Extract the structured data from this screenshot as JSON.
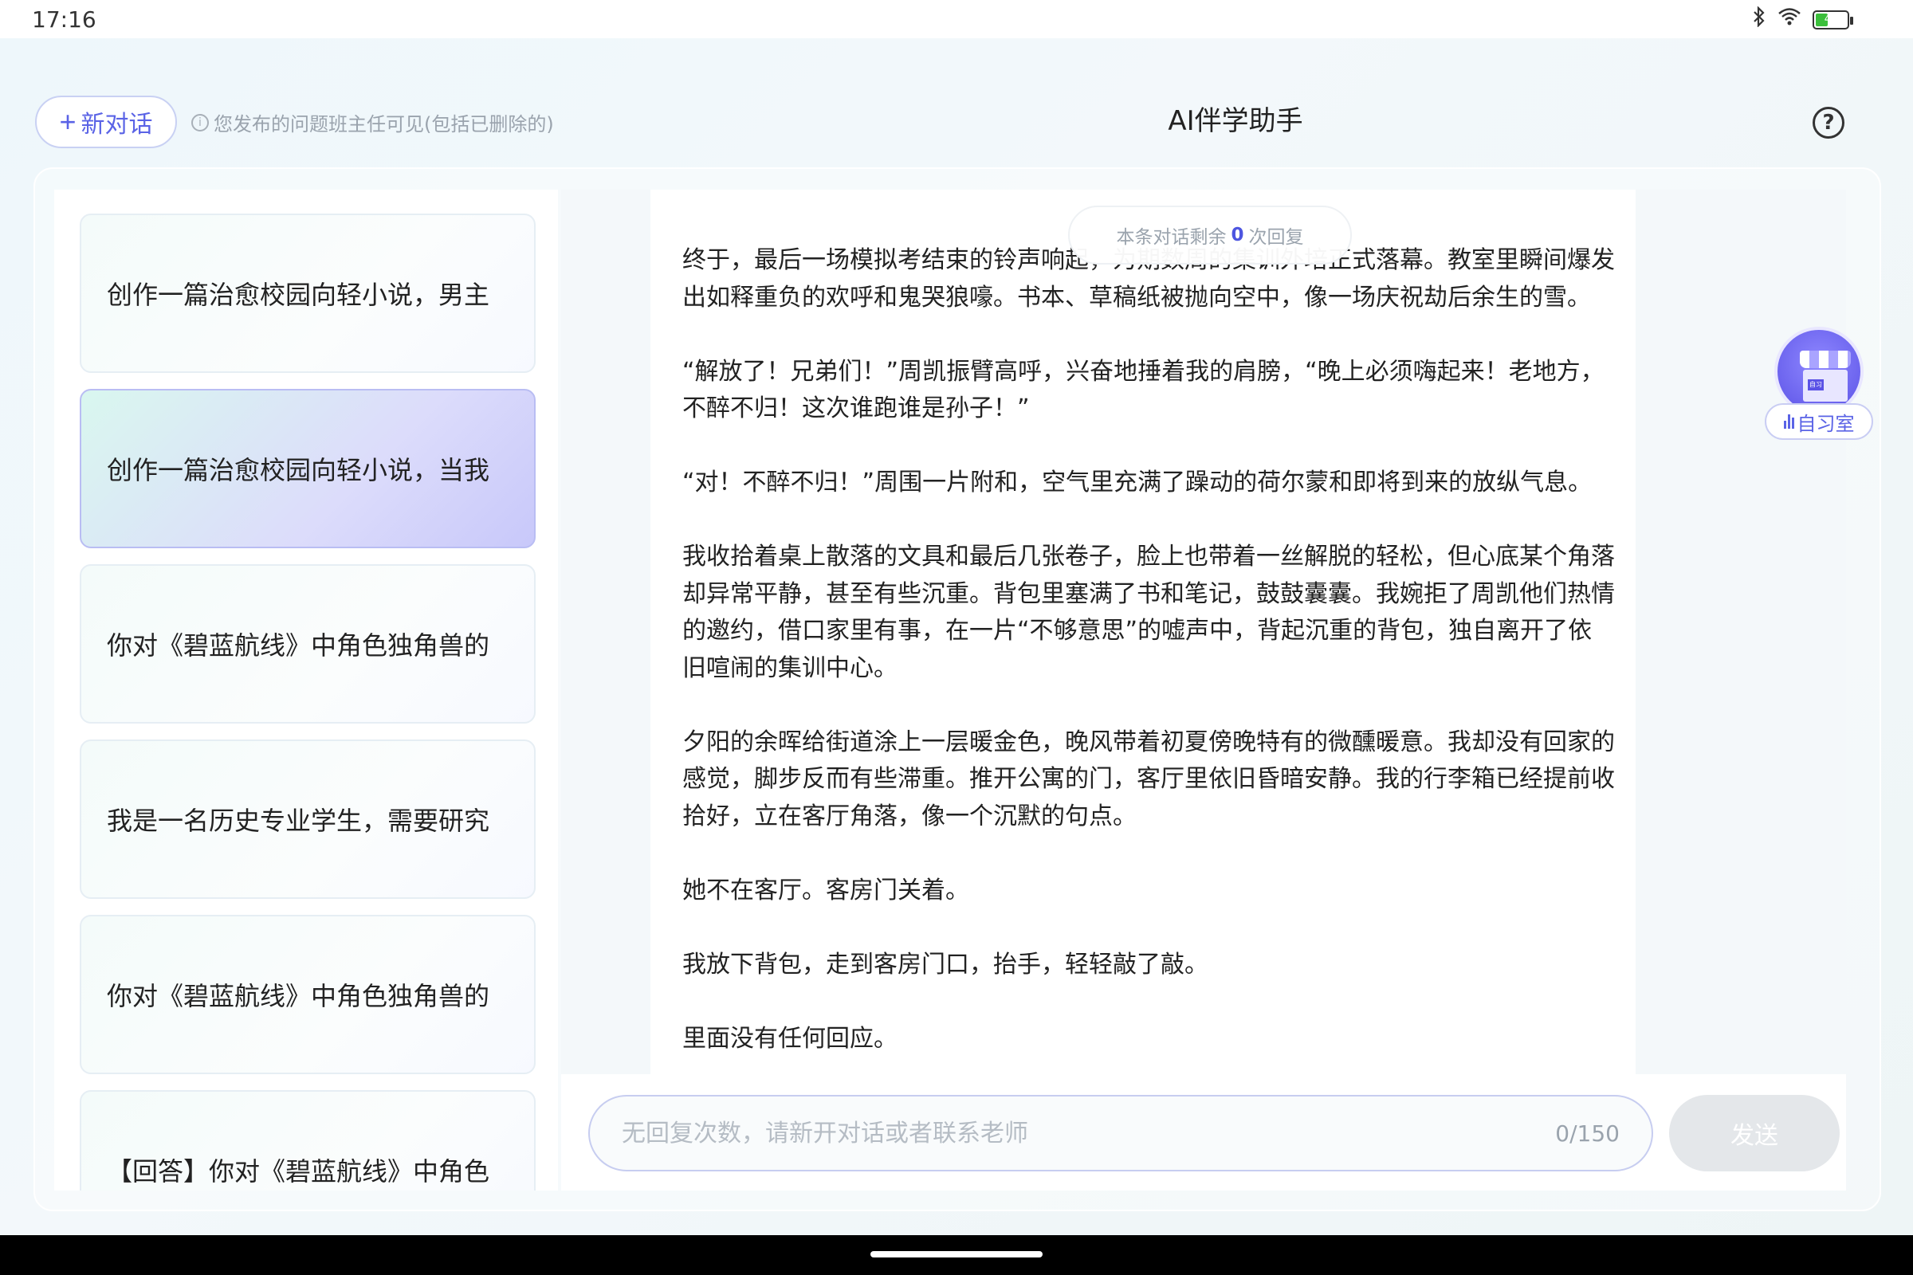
{
  "status_bar": {
    "time": "17:16",
    "battery_level": 46,
    "battery_label": "46"
  },
  "header": {
    "new_chat_label": "新对话",
    "notice": "您发布的问题班主任可见(包括已删除的)",
    "title": "AI伴学助手",
    "help_glyph": "?"
  },
  "conversations": [
    {
      "label": "创作一篇治愈校园向轻小说，男主",
      "active": false
    },
    {
      "label": "创作一篇治愈校园向轻小说，当我",
      "active": true
    },
    {
      "label": "你对《碧蓝航线》中角色独角兽的",
      "active": false
    },
    {
      "label": "我是一名历史专业学生，需要研究",
      "active": false
    },
    {
      "label": "你对《碧蓝航线》中角色独角兽的",
      "active": false
    },
    {
      "label": "【回答】你对《碧蓝航线》中角色",
      "active": false
    }
  ],
  "remaining": {
    "prefix": "本条对话剩余",
    "count": "0",
    "suffix": "次回复"
  },
  "message": {
    "paragraphs": [
      "终于，最后一场模拟考结束的铃声响起，为期数周的集训外培正式落幕。教室里瞬间爆发出如释重负的欢呼和鬼哭狼嚎。书本、草稿纸被抛向空中，像一场庆祝劫后余生的雪。",
      "“解放了！兄弟们！”周凯振臂高呼，兴奋地捶着我的肩膀，“晚上必须嗨起来！老地方，不醉不归！这次谁跑谁是孙子！”",
      "“对！不醉不归！”周围一片附和，空气里充满了躁动的荷尔蒙和即将到来的放纵气息。",
      "我收拾着桌上散落的文具和最后几张卷子，脸上也带着一丝解脱的轻松，但心底某个角落却异常平静，甚至有些沉重。背包里塞满了书和笔记，鼓鼓囊囊。我婉拒了周凯他们热情的邀约，借口家里有事，在一片“不够意思”的嘘声中，背起沉重的背包，独自离开了依旧喧闹的集训中心。",
      "夕阳的余晖给街道涂上一层暖金色，晚风带着初夏傍晚特有的微醺暖意。我却没有回家的感觉，脚步反而有些滞重。推开公寓的门，客厅里依旧昏暗安静。我的行李箱已经提前收拾好，立在客厅角落，像一个沉默的句点。",
      "她不在客厅。客房门关着。",
      "我放下背包，走到客房门口，抬手，轻轻敲了敲。",
      "里面没有任何回应。"
    ]
  },
  "input": {
    "placeholder": "无回复次数，请新开对话或者联系老师",
    "char_count": "0/150",
    "send_label": "发送"
  },
  "study_room": {
    "label": "自习室",
    "sign": "自习"
  },
  "colors": {
    "accent": "#5a63e6",
    "active_item_start": "#d9f7ef",
    "active_item_end": "#c8c8fa"
  }
}
